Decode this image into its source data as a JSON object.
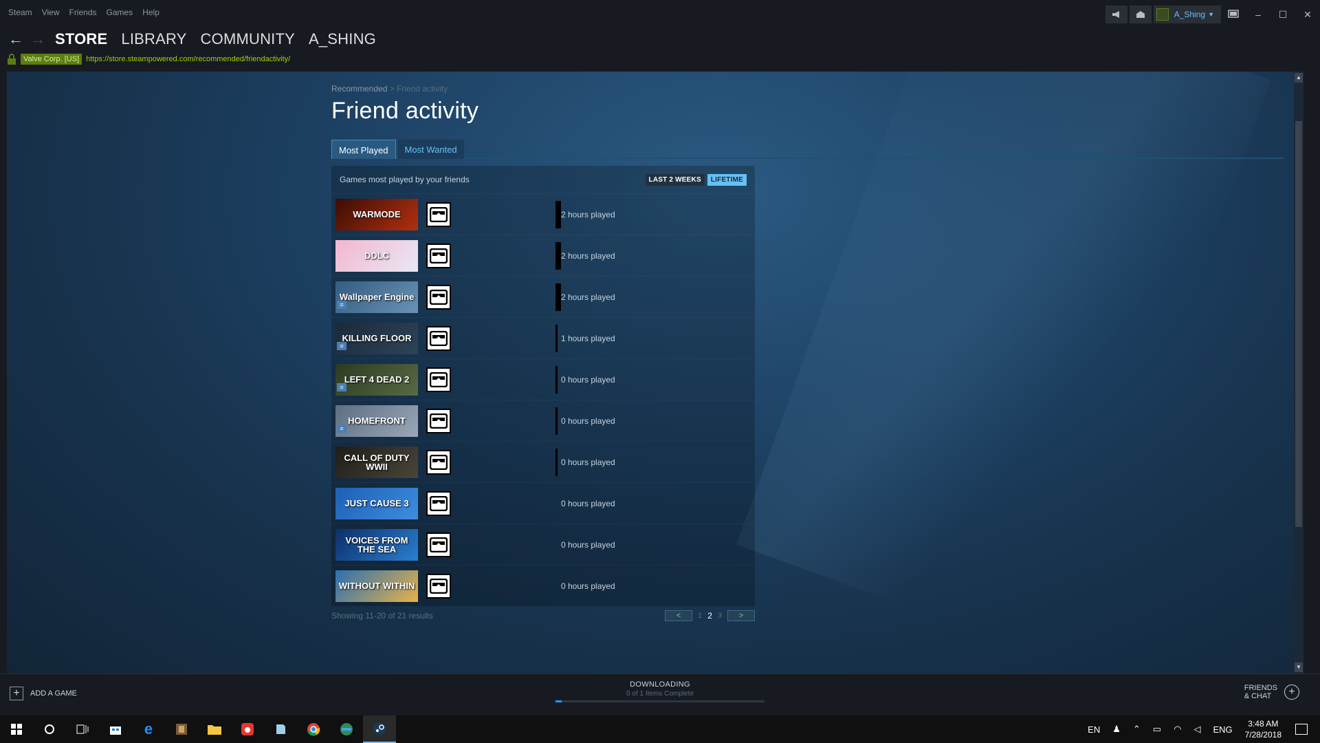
{
  "menubar": {
    "items": [
      "Steam",
      "View",
      "Friends",
      "Games",
      "Help"
    ],
    "username": "A_Shing"
  },
  "nav": {
    "links": [
      "STORE",
      "LIBRARY",
      "COMMUNITY",
      "A_SHING"
    ],
    "cert": "Valve Corp. [US]",
    "url": "https://store.steampowered.com/recommended/friendactivity/"
  },
  "page": {
    "breadcrumb_root": "Recommended",
    "breadcrumb_sep": ">",
    "breadcrumb_current": "Friend activity",
    "title": "Friend activity",
    "tabs": [
      "Most Played",
      "Most Wanted"
    ],
    "panel_subtitle": "Games most played by your friends",
    "toggles": [
      "LAST 2 WEEKS",
      "LIFETIME"
    ],
    "showing": "Showing 11-20 of 21 results",
    "pager": {
      "prev": "<",
      "next": ">",
      "pages": [
        "1",
        "2",
        "3"
      ],
      "current": "2"
    }
  },
  "games": [
    {
      "title": "WARMODE",
      "hours": "2 hours played",
      "colors": [
        "#3a0c05",
        "#b3300f"
      ],
      "dlc": false,
      "bar": "thick"
    },
    {
      "title": "DDLC",
      "hours": "2 hours played",
      "colors": [
        "#f4b6cf",
        "#e8e8f5"
      ],
      "dlc": false,
      "bar": "thick"
    },
    {
      "title": "Wallpaper Engine",
      "hours": "2 hours played",
      "colors": [
        "#355c80",
        "#6a92b4"
      ],
      "dlc": true,
      "bar": "thick"
    },
    {
      "title": "KILLING FLOOR",
      "hours": "1 hours played",
      "colors": [
        "#1b2a3a",
        "#2d4457"
      ],
      "dlc": true,
      "bar": "thin"
    },
    {
      "title": "LEFT 4 DEAD 2",
      "hours": "0 hours played",
      "colors": [
        "#2a3b22",
        "#5a6a44"
      ],
      "dlc": true,
      "bar": "thin"
    },
    {
      "title": "HOMEFRONT",
      "hours": "0 hours played",
      "colors": [
        "#5d6e82",
        "#9aa8b8"
      ],
      "dlc": true,
      "bar": "thin"
    },
    {
      "title": "CALL OF DUTY WWII",
      "hours": "0 hours played",
      "colors": [
        "#1e1d18",
        "#4a453a"
      ],
      "dlc": false,
      "bar": "thin"
    },
    {
      "title": "JUST CAUSE 3",
      "hours": "0 hours played",
      "colors": [
        "#1d5fb5",
        "#3d8ee0"
      ],
      "dlc": false,
      "bar": "none"
    },
    {
      "title": "VOICES FROM THE SEA",
      "hours": "0 hours played",
      "colors": [
        "#0d2e6a",
        "#2a7fd0"
      ],
      "dlc": false,
      "bar": "none"
    },
    {
      "title": "WITHOUT WITHIN",
      "hours": "0 hours played",
      "colors": [
        "#2a6fb0",
        "#e8b34a"
      ],
      "dlc": false,
      "bar": "none"
    }
  ],
  "bottom": {
    "add_game": "ADD A GAME",
    "downloading": "DOWNLOADING",
    "download_status": "0 of 1 Items Complete",
    "download_progress": 0.03,
    "friends_chat_1": "FRIENDS",
    "friends_chat_2": "& CHAT"
  },
  "taskbar": {
    "lang": "EN",
    "ime": "ENG",
    "time": "3:48 AM",
    "date": "7/28/2018"
  },
  "colors": {
    "accent": "#66c0f4",
    "background": "#1b2838",
    "url_green": "#a4d007"
  }
}
